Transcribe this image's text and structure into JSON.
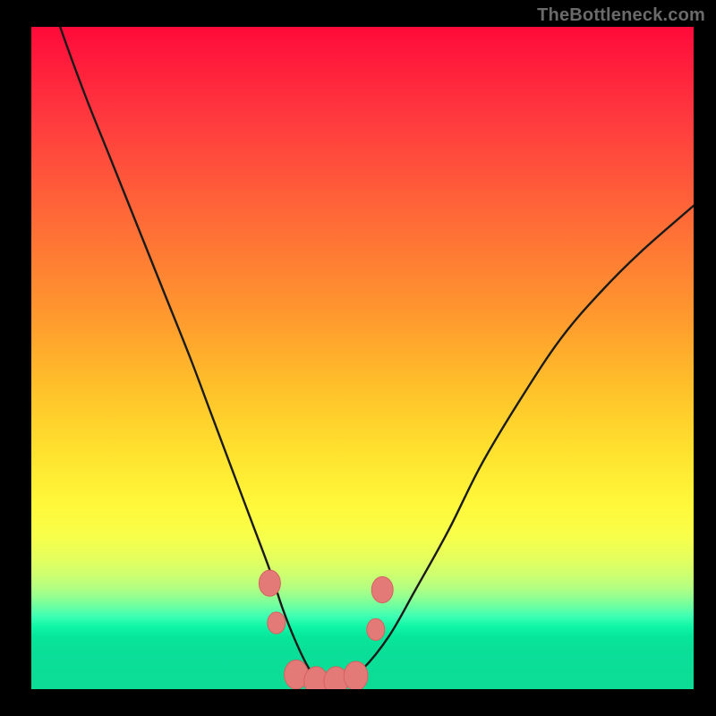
{
  "watermark": "TheBottleneck.com",
  "colors": {
    "frame": "#000000",
    "curve_stroke": "#1a1a1a",
    "marker_fill": "#e47a78",
    "marker_stroke": "#d5615f",
    "watermark": "#6a6a6a"
  },
  "chart_data": {
    "type": "line",
    "title": "",
    "xlabel": "",
    "ylabel": "",
    "xlim": [
      0,
      100
    ],
    "ylim": [
      0,
      100
    ],
    "grid": false,
    "legend": null,
    "series": [
      {
        "name": "bottleneck-curve",
        "x": [
          0,
          4,
          8,
          12,
          16,
          20,
          24,
          27,
          30,
          33,
          36,
          38,
          40,
          42,
          44,
          47,
          50,
          54,
          58,
          63,
          68,
          74,
          80,
          86,
          92,
          100
        ],
        "y": [
          113,
          101,
          90,
          80,
          70,
          60,
          50,
          42,
          34,
          26,
          18,
          12,
          7,
          3,
          1,
          1,
          3,
          8,
          15,
          24,
          34,
          44,
          53,
          60,
          66,
          73
        ]
      }
    ],
    "markers": [
      {
        "name": "left-anchor",
        "x": 36.0,
        "y": 16.0,
        "size": 1.8
      },
      {
        "name": "left-drop",
        "x": 37.0,
        "y": 10.0,
        "size": 1.5
      },
      {
        "name": "bottom-1",
        "x": 40.0,
        "y": 2.2,
        "size": 2.0
      },
      {
        "name": "bottom-2",
        "x": 43.0,
        "y": 1.2,
        "size": 2.0
      },
      {
        "name": "bottom-3",
        "x": 46.0,
        "y": 1.2,
        "size": 2.0
      },
      {
        "name": "bottom-4",
        "x": 49.0,
        "y": 2.0,
        "size": 2.0
      },
      {
        "name": "right-rise",
        "x": 52.0,
        "y": 9.0,
        "size": 1.5
      },
      {
        "name": "right-anchor",
        "x": 53.0,
        "y": 15.0,
        "size": 1.8
      }
    ],
    "gradient_stops": [
      {
        "pct": 0,
        "color": "#ff0a3a"
      },
      {
        "pct": 50,
        "color": "#ffbf2a"
      },
      {
        "pct": 75,
        "color": "#fff83a"
      },
      {
        "pct": 88,
        "color": "#5effad"
      },
      {
        "pct": 100,
        "color": "#0cdc96"
      }
    ]
  }
}
